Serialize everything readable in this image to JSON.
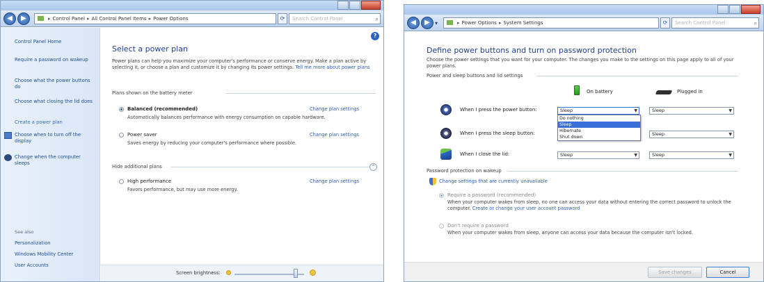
{
  "window1": {
    "address": {
      "parts": [
        "Control Panel",
        "All Control Panel Items",
        "Power Options"
      ]
    },
    "search_placeholder": "Search Control Panel",
    "left_pane": {
      "home": "Control Panel Home",
      "links": [
        "Require a password on wakeup",
        "Choose what the power buttons do",
        "Choose what closing the lid does",
        "Create a power plan",
        "Choose when to turn off the display",
        "Change when the computer sleeps"
      ],
      "see_also_heading": "See also",
      "see_also": [
        "Personalization",
        "Windows Mobility Center",
        "User Accounts"
      ]
    },
    "title": "Select a power plan",
    "intro": "Power plans can help you maximize your computer's performance or conserve energy. Make a plan active by selecting it, or choose a plan and customize it by changing its power settings.",
    "intro_link": "Tell me more about power plans",
    "section_plans": "Plans shown on the battery meter",
    "plans": [
      {
        "name": "Balanced (recommended)",
        "desc": "Automatically balances performance with energy consumption on capable hardware.",
        "link": "Change plan settings",
        "selected": true
      },
      {
        "name": "Power saver",
        "desc": "Saves energy by reducing your computer's performance where possible.",
        "link": "Change plan settings",
        "selected": false
      }
    ],
    "section_hidden": "Hide additional plans",
    "hidden_plans": [
      {
        "name": "High performance",
        "desc": "Favors performance, but may use more energy.",
        "link": "Change plan settings",
        "selected": false
      }
    ],
    "brightness_label": "Screen brightness:",
    "brightness_level": 0.88
  },
  "window2": {
    "address": {
      "parts": [
        "Power Options",
        "System Settings"
      ]
    },
    "search_placeholder": "Search Control Panel",
    "title": "Define power buttons and turn on password protection",
    "intro": "Choose the power settings that you want for your computer. The changes you make to the settings on this page apply to all of your power plans.",
    "section_buttons": "Power and sleep buttons and lid settings",
    "col_battery": "On battery",
    "col_plugged": "Plugged in",
    "rows": [
      {
        "label": "When I press the power button:",
        "battery": "Sleep",
        "plugged": "Sleep"
      },
      {
        "label": "When I press the sleep button:",
        "battery": "Sleep",
        "plugged": "Sleep"
      },
      {
        "label": "When I close the lid:",
        "battery": "Sleep",
        "plugged": "Sleep"
      }
    ],
    "dropdown_options": [
      "Do nothing",
      "Sleep",
      "Hibernate",
      "Shut down"
    ],
    "dropdown_selected": "Sleep",
    "section_password": "Password protection on wakeup",
    "change_settings_link": "Change settings that are currently unavailable",
    "password_options": [
      {
        "name": "Require a password (recommended)",
        "desc": "When your computer wakes from sleep, no one can access your data without entering the correct password to unlock the computer.",
        "link": "Create or change your user account password",
        "selected": true
      },
      {
        "name": "Don't require a password",
        "desc": "When your computer wakes from sleep, anyone can access your data because the computer isn't locked.",
        "link": "",
        "selected": false
      }
    ],
    "save_button": "Save changes",
    "cancel_button": "Cancel"
  },
  "colors": {
    "title_blue": "#1e3d8f",
    "link_blue": "#2a5db3",
    "selection_blue": "#3a6fd8"
  }
}
